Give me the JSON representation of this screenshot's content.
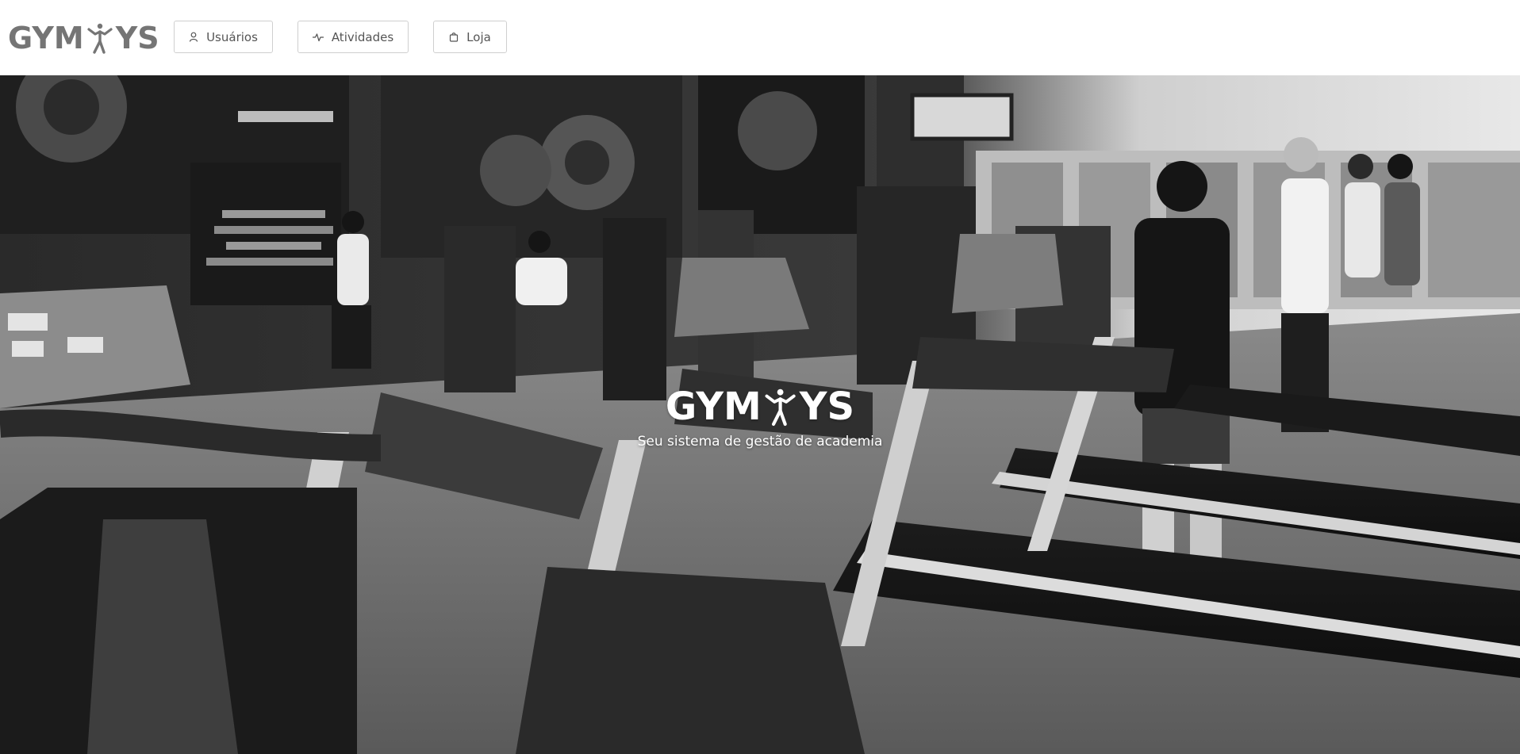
{
  "brand": {
    "left": "GYM",
    "right": "YS",
    "icon": "athlete-figure-icon"
  },
  "nav": {
    "users_label": "Usuários",
    "users_icon": "user-icon",
    "activities_label": "Atividades",
    "activities_icon": "activity-pulse-icon",
    "store_label": "Loja",
    "store_icon": "shopping-bag-icon"
  },
  "hero": {
    "logo_left": "GYM",
    "logo_right": "YS",
    "tagline": "Seu sistema de gestão de academia",
    "background": "grayscale gym photo with treadmills"
  },
  "colors": {
    "brand_gray": "#757575",
    "nav_border": "#cfcfcf",
    "nav_text": "#555555",
    "hero_text": "#ffffff"
  }
}
